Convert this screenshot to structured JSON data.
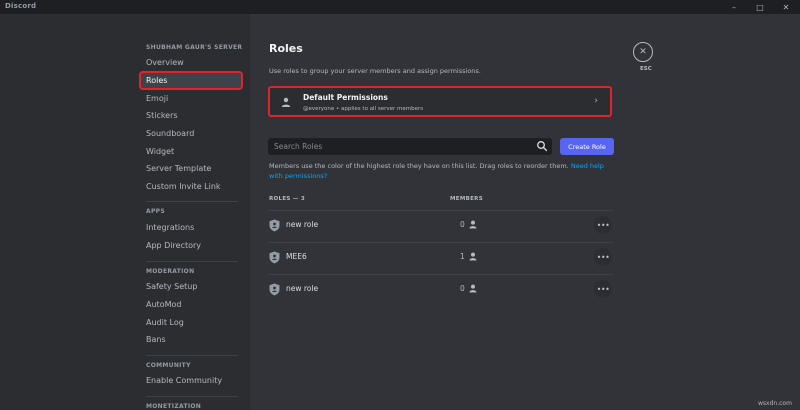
{
  "window": {
    "title": "Discord",
    "controls": [
      "minimize-icon",
      "maximize-icon",
      "close-icon"
    ]
  },
  "sidebar": {
    "server_header": "SHUBHAM GAUR'S SERVER",
    "server_items": [
      "Overview",
      "Roles",
      "Emoji",
      "Stickers",
      "Soundboard",
      "Widget",
      "Server Template",
      "Custom Invite Link"
    ],
    "active_item": "Roles",
    "apps_header": "APPS",
    "apps_items": [
      "Integrations",
      "App Directory"
    ],
    "moderation_header": "MODERATION",
    "moderation_items": [
      "Safety Setup",
      "AutoMod",
      "Audit Log",
      "Bans"
    ],
    "community_header": "COMMUNITY",
    "community_items": [
      "Enable Community"
    ],
    "monetization_header": "MONETIZATION"
  },
  "main": {
    "title": "Roles",
    "description": "Use roles to group your server members and assign permissions.",
    "default_permissions": {
      "title": "Default Permissions",
      "subtitle": "@everyone • applies to all server members"
    },
    "search": {
      "placeholder": "Search Roles"
    },
    "create_button": "Create Role",
    "info_text": "Members use the color of the highest role they have on this list. Drag roles to reorder them.",
    "info_link": "Need help with permissions?",
    "roles_header": "ROLES — 3",
    "members_header": "MEMBERS",
    "roles": [
      {
        "name": "new role",
        "members": "0"
      },
      {
        "name": "MEE6",
        "members": "1"
      },
      {
        "name": "new role",
        "members": "0"
      }
    ],
    "close_label": "ESC"
  },
  "watermark": "wsxdn.com",
  "colors": {
    "accent": "#5865f2",
    "highlight": "#e0242e",
    "link": "#00a8fc",
    "sidebar_bg": "#2b2d31",
    "main_bg": "#313338"
  }
}
